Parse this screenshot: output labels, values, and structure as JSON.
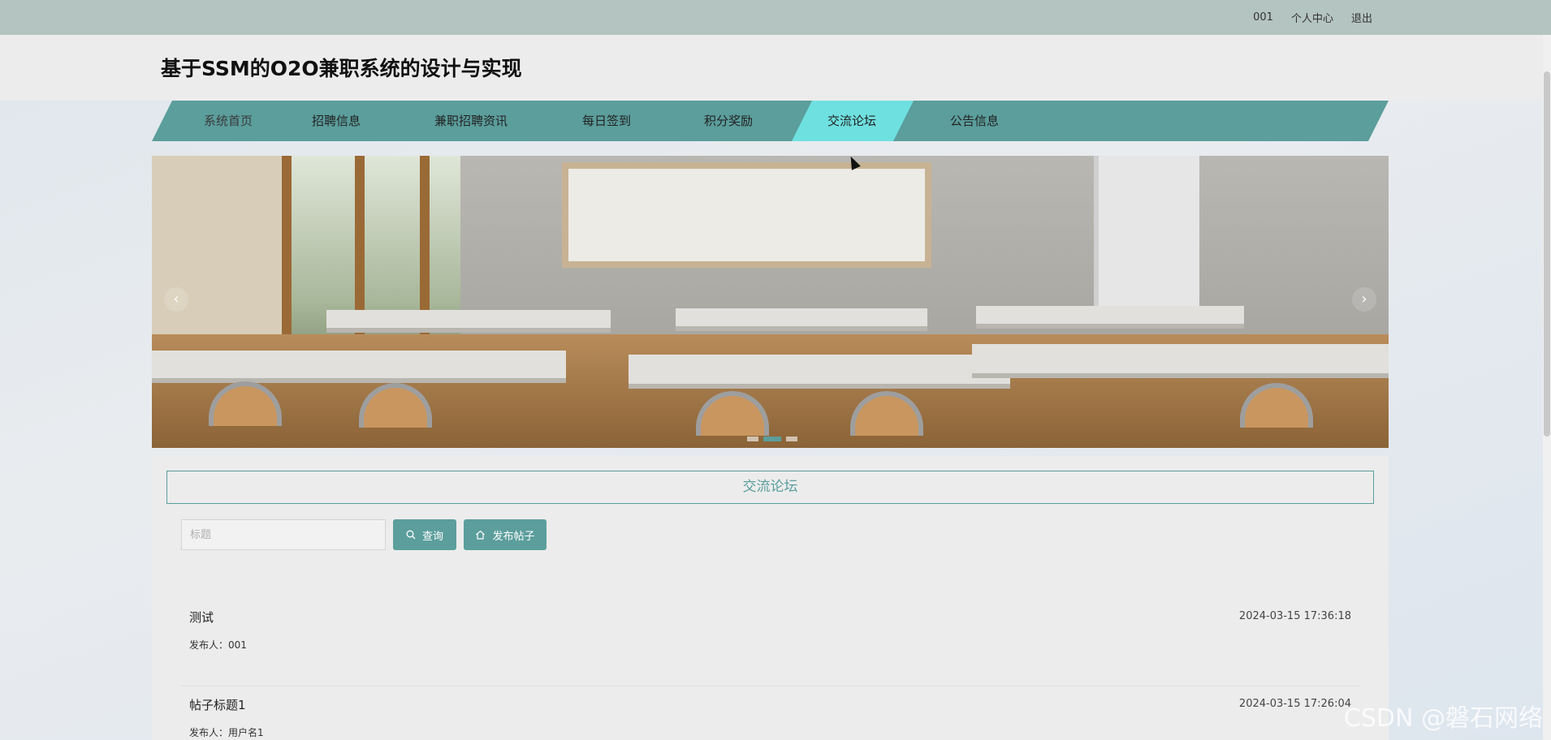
{
  "topbar": {
    "username": "001",
    "profile_label": "个人中心",
    "logout_label": "退出"
  },
  "header": {
    "title": "基于SSM的O2O兼职系统的设计与实现"
  },
  "nav": {
    "items": [
      {
        "label": "系统首页"
      },
      {
        "label": "招聘信息"
      },
      {
        "label": "兼职招聘资讯"
      },
      {
        "label": "每日签到"
      },
      {
        "label": "积分奖励"
      },
      {
        "label": "交流论坛",
        "active": true
      },
      {
        "label": "公告信息"
      }
    ],
    "accent_color": "#5b9e9c",
    "active_color": "#6fe0e0"
  },
  "banner": {
    "prev_icon": "‹",
    "next_icon": "›",
    "slide_count": 3,
    "active_slide": 2
  },
  "forum": {
    "section_title": "交流论坛",
    "search_placeholder": "标题",
    "search_button": "查询",
    "post_button": "发布帖子",
    "posts": [
      {
        "title": "测试",
        "author": "发布人：001",
        "time": "2024-03-15 17:36:18"
      },
      {
        "title": "帖子标题1",
        "author": "发布人：用户名1",
        "time": "2024-03-15 17:26:04"
      }
    ]
  },
  "watermark": "CSDN @磐石网络"
}
